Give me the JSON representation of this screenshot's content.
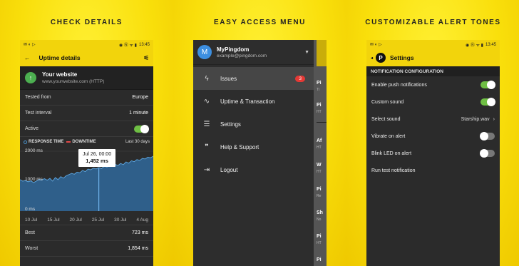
{
  "panel1": {
    "caption": "CHECK DETAILS",
    "status": {
      "time": "13:45"
    },
    "appbar": {
      "title": "Uptime details"
    },
    "site": {
      "name": "Your website",
      "url": "www.yourwebsite.com (HTTP)"
    },
    "rows": [
      {
        "label": "Tested from",
        "value": "Europe"
      },
      {
        "label": "Test interval",
        "value": "1 minute"
      },
      {
        "label": "Active",
        "value": ""
      }
    ],
    "legend": {
      "response": "RESPONSE TIME",
      "downtime": "DOWNTIME",
      "range": "Last 30 days"
    },
    "tooltip": {
      "date": "Jul 26, 00:00",
      "value": "1,452 ms"
    },
    "chart_data": {
      "type": "area",
      "title": "",
      "series": [
        {
          "name": "RESPONSE TIME",
          "values": [
            1050,
            1000,
            1020,
            980,
            1010,
            950,
            1000,
            1060,
            1040,
            1080,
            1030,
            1090,
            1000,
            1120,
            1050,
            1150,
            1100,
            1180,
            1220,
            1260,
            1230,
            1300,
            1280,
            1360,
            1320,
            1400,
            1380,
            1430,
            1410,
            1452,
            1420,
            1500,
            1470,
            1540,
            1500,
            1560,
            1520,
            1590,
            1550,
            1640,
            1600,
            1680,
            1650,
            1720,
            1690,
            1760,
            1740,
            1800,
            1780,
            1830
          ]
        }
      ],
      "ylabels": [
        "2000 ms",
        "1000 ms",
        "0 ms"
      ],
      "ylim": [
        0,
        2000
      ],
      "xlabels": [
        "10 Jul",
        "15 Jul",
        "20 Jul",
        "25 Jul",
        "30 Jul",
        "4 Aug"
      ]
    },
    "stats": [
      {
        "label": "Best",
        "value": "723 ms"
      },
      {
        "label": "Worst",
        "value": "1,854 ms"
      }
    ]
  },
  "panel2": {
    "caption": "EASY ACCESS MENU",
    "user": {
      "initial": "M",
      "name": "MyPingdom",
      "email": "example@pingdom.com"
    },
    "items": [
      {
        "label": "Issues",
        "badge": "3"
      },
      {
        "label": "Uptime & Transaction"
      },
      {
        "label": "Settings"
      },
      {
        "label": "Help & Support"
      },
      {
        "label": "Logout"
      }
    ],
    "behind": [
      "Pi",
      "Ti",
      "Pi",
      "HT",
      "Af",
      "HT",
      "W",
      "HT",
      "Pi",
      "Re",
      "Sh",
      "No",
      "Pi",
      "HT",
      "Pi",
      "HT"
    ]
  },
  "panel3": {
    "caption": "CUSTOMIZABLE ALERT TONES",
    "status": {
      "time": "13:45"
    },
    "appbar": {
      "title": "Settings",
      "logo": "P"
    },
    "section": "NOTIFICATION CONFIGURATION",
    "rows": [
      {
        "label": "Enable push notifications",
        "value": ""
      },
      {
        "label": "Custom sound",
        "value": ""
      },
      {
        "label": "Select sound",
        "value": "Starship.wav"
      },
      {
        "label": "Vibrate on alert",
        "value": ""
      },
      {
        "label": "Blink LED on alert",
        "value": ""
      },
      {
        "label": "Run test notification",
        "value": ""
      }
    ]
  }
}
